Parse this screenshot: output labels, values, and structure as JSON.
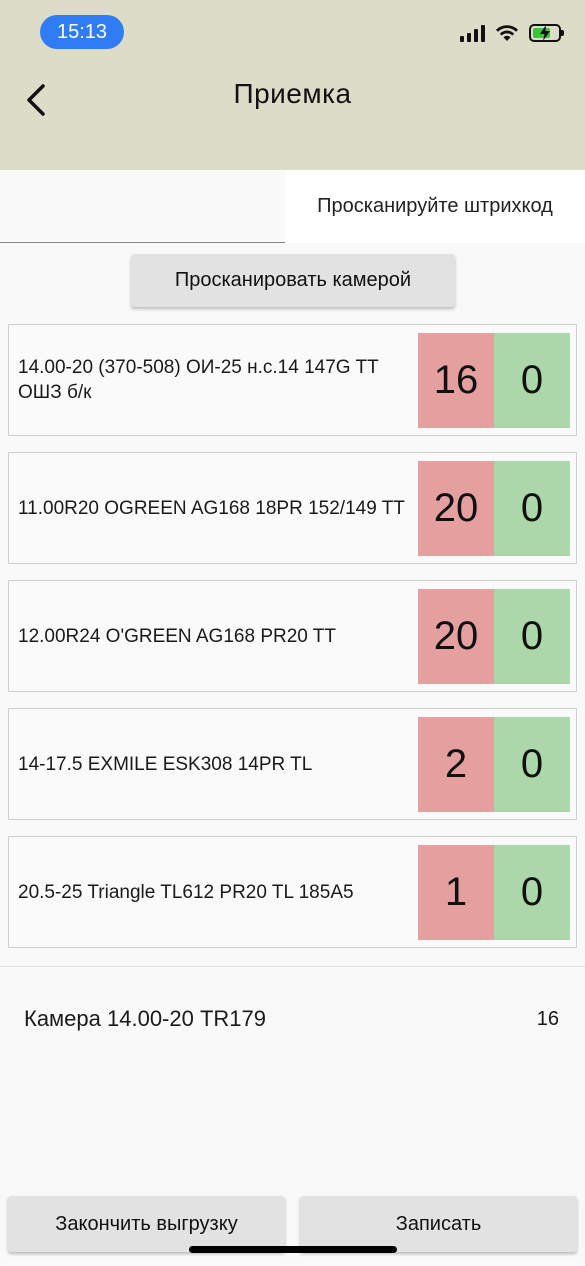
{
  "status_bar": {
    "time": "15:13",
    "icons": [
      "cellular-signal-icon",
      "wifi-icon",
      "battery-charging-icon"
    ]
  },
  "header": {
    "title": "Приемка",
    "back_icon": "chevron-left-icon",
    "background_color": "#dcdcc9"
  },
  "scan": {
    "input_value": "",
    "hint": "Просканируйте штрихкод",
    "camera_button_label": "Просканировать камерой"
  },
  "items": [
    {
      "name": "14.00-20 (370-508) ОИ-25 н.с.14 147G TT ОШЗ б/к",
      "expected": "16",
      "scanned": "0"
    },
    {
      "name": "11.00R20 OGREEN AG168 18PR 152/149 TT",
      "expected": "20",
      "scanned": "0"
    },
    {
      "name": "12.00R24 O'GREEN AG168 PR20 TT",
      "expected": "20",
      "scanned": "0"
    },
    {
      "name": "14-17.5 EXMILE ESK308 14PR TL",
      "expected": "2",
      "scanned": "0"
    },
    {
      "name": "20.5-25 Triangle TL612 PR20 TL 185A5",
      "expected": "1",
      "scanned": "0"
    }
  ],
  "summary": {
    "name": "Камера 14.00-20 TR179",
    "count": "16"
  },
  "actions": {
    "finish_label": "Закончить выгрузку",
    "save_label": "Записать"
  },
  "colors": {
    "expected_bg": "#e3a09f",
    "scanned_bg": "#abd7ab",
    "time_pill": "#2f7cf6",
    "battery_fill": "#3ec13e"
  }
}
